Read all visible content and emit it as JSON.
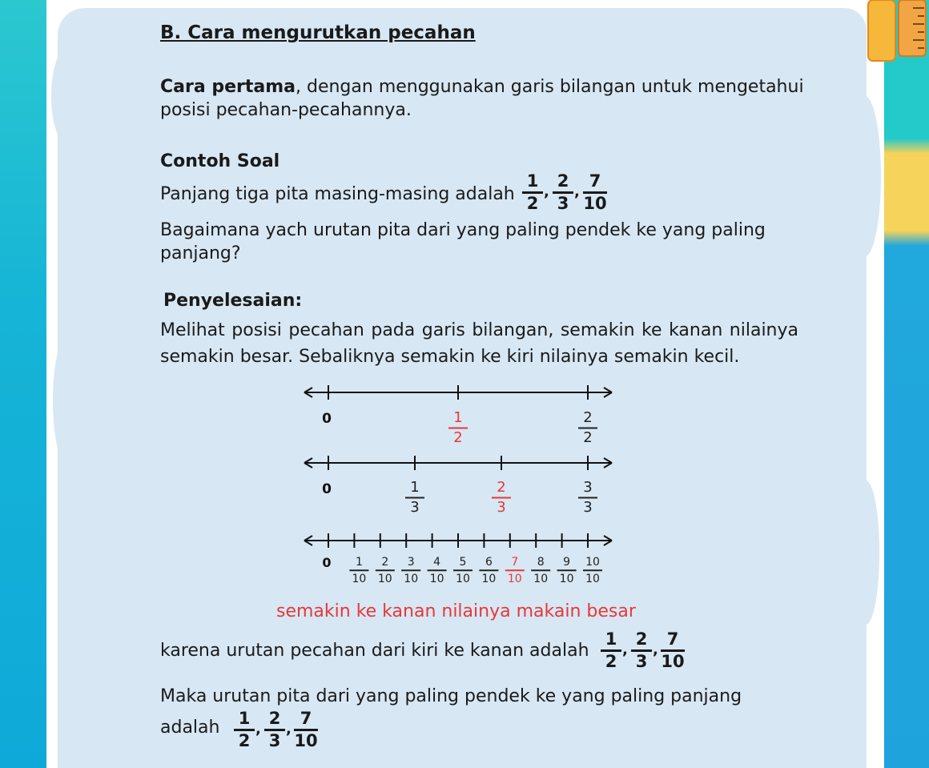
{
  "title": "B. Cara mengurutkan pecahan",
  "intro": {
    "bold": "Cara pertama",
    "line1": ", dengan menggunakan garis bilangan untuk mengetahui",
    "line2": "posisi pecahan-pecahannya."
  },
  "example": {
    "heading": "Contoh Soal",
    "line1": "Panjang tiga pita masing-masing adalah",
    "line2": "Bagaimana yach urutan pita dari yang paling pendek ke yang paling",
    "line3": "panjang?"
  },
  "solution": {
    "heading": "Penyelesaian:",
    "line1": "Melihat posisi pecahan pada garis bilangan, semakin ke kanan nilainya",
    "line2": "semakin besar. Sebaliknya semakin ke kiri nilainya semakin kecil."
  },
  "fractions": [
    {
      "num": "1",
      "den": "2"
    },
    {
      "num": "2",
      "den": "3"
    },
    {
      "num": "7",
      "den": "10"
    }
  ],
  "number_lines": {
    "zero_label": "0",
    "line_halves": [
      {
        "num": "1",
        "den": "2",
        "highlight": true
      },
      {
        "num": "2",
        "den": "2",
        "highlight": false
      }
    ],
    "line_thirds": [
      {
        "num": "1",
        "den": "3",
        "highlight": false
      },
      {
        "num": "2",
        "den": "3",
        "highlight": true
      },
      {
        "num": "3",
        "den": "3",
        "highlight": false
      }
    ],
    "line_tenths": [
      {
        "num": "1",
        "den": "10",
        "highlight": false
      },
      {
        "num": "2",
        "den": "10",
        "highlight": false
      },
      {
        "num": "3",
        "den": "10",
        "highlight": false
      },
      {
        "num": "4",
        "den": "10",
        "highlight": false
      },
      {
        "num": "5",
        "den": "10",
        "highlight": false
      },
      {
        "num": "6",
        "den": "10",
        "highlight": false
      },
      {
        "num": "7",
        "den": "10",
        "highlight": true
      },
      {
        "num": "8",
        "den": "10",
        "highlight": false
      },
      {
        "num": "9",
        "den": "10",
        "highlight": false
      },
      {
        "num": "10",
        "den": "10",
        "highlight": false
      }
    ]
  },
  "note_red": "semakin ke kanan nilainya makain besar",
  "conclusion": {
    "line1": "karena urutan pecahan dari kiri ke kanan adalah",
    "line2": "Maka urutan pita dari yang paling pendek ke yang paling panjang",
    "line3": "adalah"
  },
  "colors": {
    "highlight": "#e5393b",
    "panel": "#d7e7f3",
    "frame_left": "#16b4d6",
    "frame_right": "#1fa3dc",
    "ruler": "#f6b83a"
  }
}
